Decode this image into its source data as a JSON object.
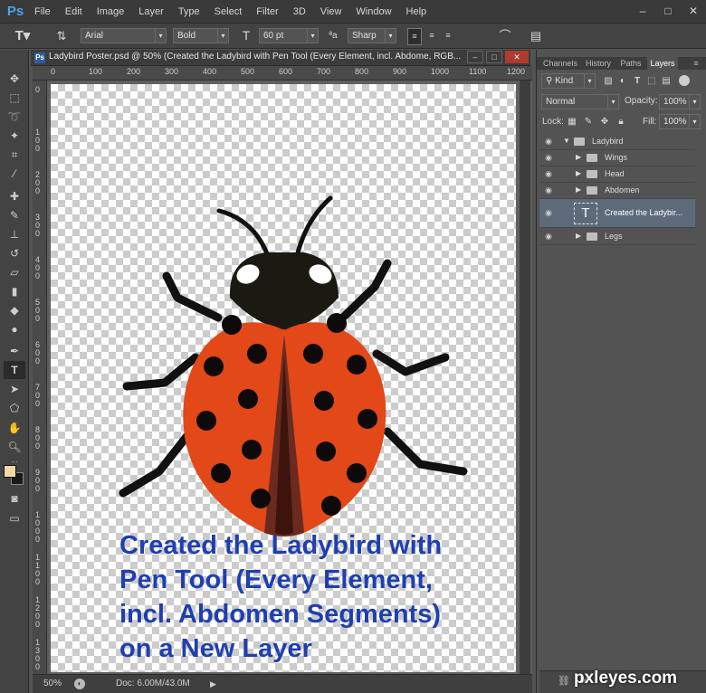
{
  "app": {
    "logo": "Ps"
  },
  "menu": [
    "File",
    "Edit",
    "Image",
    "Layer",
    "Type",
    "Select",
    "Filter",
    "3D",
    "View",
    "Window",
    "Help"
  ],
  "window_controls": [
    "–",
    "□",
    "✕"
  ],
  "options_bar": {
    "font_family": "Arial",
    "font_style": "Bold",
    "font_size": "60 pt",
    "aa_label": "ªa",
    "antialias": "Sharp",
    "text_color": "#1a2fb5"
  },
  "document": {
    "title": "Ladybird Poster.psd @ 50% (Created the Ladybird with Pen Tool (Every Element, incl. Abdome, RGB...",
    "ruler_h": [
      "0",
      "100",
      "200",
      "300",
      "400",
      "500",
      "600",
      "700",
      "800",
      "900",
      "1000",
      "1100",
      "1200"
    ],
    "ruler_v": [
      "0",
      "100",
      "200",
      "300",
      "400",
      "500",
      "600",
      "700",
      "800",
      "900",
      "1000",
      "1100",
      "1200",
      "1300"
    ],
    "poster_text": [
      "Created the Ladybird with",
      "Pen Tool (Every Element,",
      "incl. Abdomen Segments)",
      "on a New Layer"
    ],
    "zoom": "50%",
    "doc_size": "Doc: 6.00M/43.0M"
  },
  "panel": {
    "tabs": [
      "Channels",
      "History",
      "Paths",
      "Layers"
    ],
    "active_tab": "Layers",
    "filter_kind": "Kind",
    "blend_mode": "Normal",
    "opacity_label": "Opacity:",
    "opacity": "100%",
    "lock_label": "Lock:",
    "fill_label": "Fill:",
    "fill": "100%",
    "layers": [
      {
        "name": "Ladybird",
        "type": "group",
        "expanded": true,
        "indent": 0
      },
      {
        "name": "Wings",
        "type": "group",
        "expanded": false,
        "indent": 1
      },
      {
        "name": "Head",
        "type": "group",
        "expanded": false,
        "indent": 1
      },
      {
        "name": "Abdomen",
        "type": "group",
        "expanded": false,
        "indent": 1
      },
      {
        "name": "Created the Ladybir...",
        "type": "text",
        "selected": true,
        "indent": 1
      },
      {
        "name": "Legs",
        "type": "group",
        "expanded": false,
        "indent": 1
      }
    ]
  },
  "watermark": "pxleyes.com",
  "colors": {
    "foreground": "#f4d9a8",
    "background": "#1a1a1a",
    "ladybird_red": "#e24818",
    "spots": "#0e0a0a"
  }
}
